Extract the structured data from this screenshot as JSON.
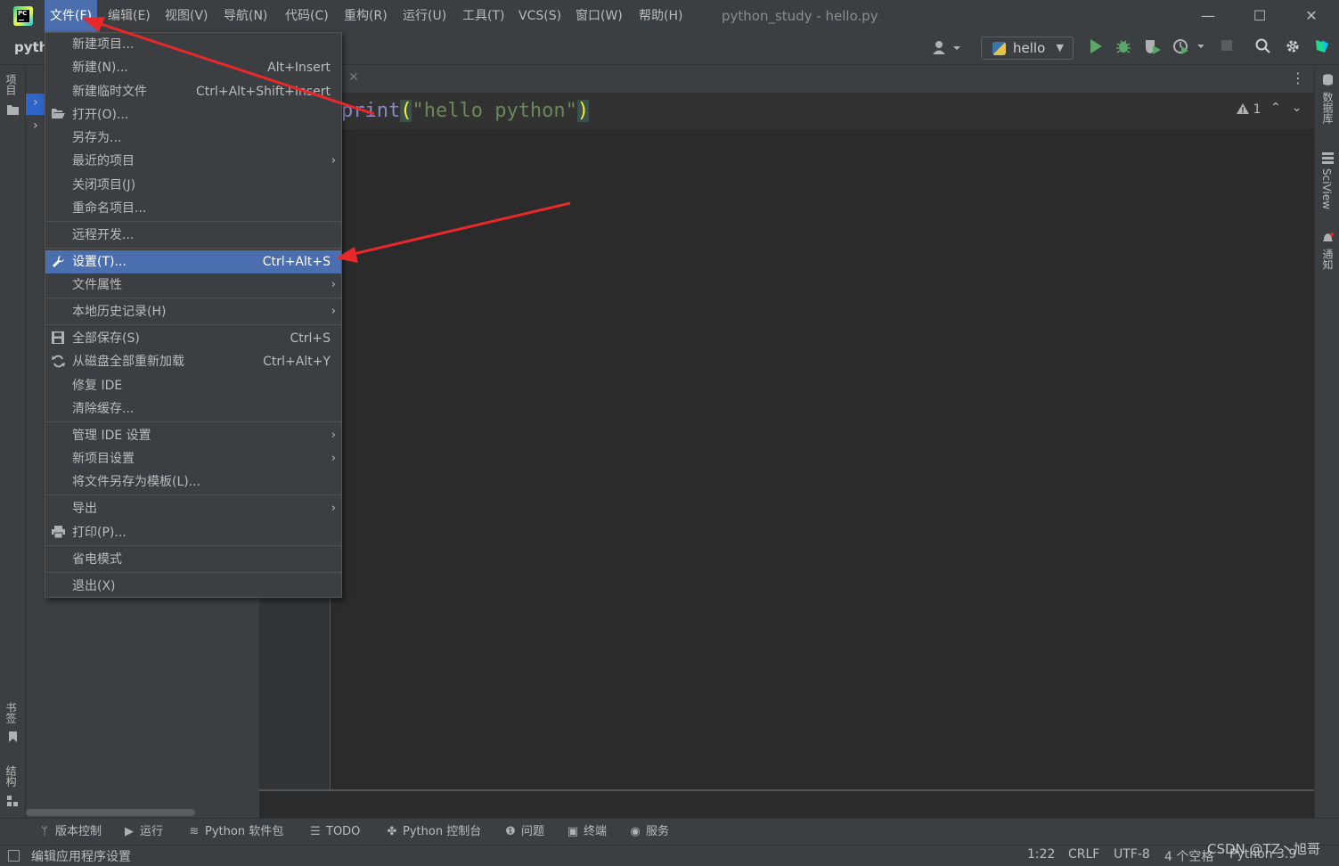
{
  "window": {
    "title": "python_study - hello.py",
    "minimize_glyph": "—",
    "maximize_glyph": "☐",
    "close_glyph": "✕"
  },
  "menubar": {
    "items": [
      "文件(F)",
      "编辑(E)",
      "视图(V)",
      "导航(N)",
      "代码(C)",
      "重构(R)",
      "运行(U)",
      "工具(T)",
      "VCS(S)",
      "窗口(W)",
      "帮助(H)"
    ],
    "active_index": 0
  },
  "toolbar": {
    "project_crumb": "pyth",
    "run_config": "hello",
    "icons": [
      "user-icon",
      "run-icon",
      "debug-icon",
      "coverage-icon",
      "profile-icon",
      "stop-icon",
      "search-icon",
      "settings-icon",
      "jetbrains-icon"
    ]
  },
  "left_strip": {
    "project_tab": "项目",
    "bookmarks_tab": "书签",
    "structure_tab": "结构"
  },
  "right_strip": {
    "database_tab": "数据库",
    "sciview_tab": "SciView",
    "notifications_tab": "通知"
  },
  "editor": {
    "code": {
      "func": "print",
      "open_paren": "(",
      "string": "\"hello python\"",
      "close_paren": ")"
    },
    "inspection_count": "1",
    "inspection_icon": "warning-icon"
  },
  "file_menu": {
    "items": [
      {
        "label": "新建项目...",
        "shortcut": "",
        "submenu": false,
        "icon": ""
      },
      {
        "label": "新建(N)...",
        "shortcut": "Alt+Insert",
        "submenu": false,
        "icon": ""
      },
      {
        "label": "新建临时文件",
        "shortcut": "Ctrl+Alt+Shift+Insert",
        "submenu": false,
        "icon": ""
      },
      {
        "label": "打开(O)...",
        "shortcut": "",
        "submenu": false,
        "icon": "folder-icon"
      },
      {
        "label": "另存为...",
        "shortcut": "",
        "submenu": false,
        "icon": ""
      },
      {
        "label": "最近的项目",
        "shortcut": "",
        "submenu": true,
        "icon": ""
      },
      {
        "label": "关闭项目(J)",
        "shortcut": "",
        "submenu": false,
        "icon": ""
      },
      {
        "label": "重命名项目...",
        "shortcut": "",
        "submenu": false,
        "icon": ""
      },
      {
        "label": "远程开发...",
        "shortcut": "",
        "submenu": false,
        "icon": ""
      },
      {
        "label": "设置(T)...",
        "shortcut": "Ctrl+Alt+S",
        "submenu": false,
        "icon": "wrench-icon",
        "selected": true
      },
      {
        "label": "文件属性",
        "shortcut": "",
        "submenu": true,
        "icon": ""
      },
      {
        "label": "本地历史记录(H)",
        "shortcut": "",
        "submenu": true,
        "icon": ""
      },
      {
        "label": "全部保存(S)",
        "shortcut": "Ctrl+S",
        "submenu": false,
        "icon": "save-icon"
      },
      {
        "label": "从磁盘全部重新加载",
        "shortcut": "Ctrl+Alt+Y",
        "submenu": false,
        "icon": "reload-icon"
      },
      {
        "label": "修复 IDE",
        "shortcut": "",
        "submenu": false,
        "icon": ""
      },
      {
        "label": "清除缓存...",
        "shortcut": "",
        "submenu": false,
        "icon": ""
      },
      {
        "label": "管理 IDE 设置",
        "shortcut": "",
        "submenu": true,
        "icon": ""
      },
      {
        "label": "新项目设置",
        "shortcut": "",
        "submenu": true,
        "icon": ""
      },
      {
        "label": "将文件另存为模板(L)...",
        "shortcut": "",
        "submenu": false,
        "icon": ""
      },
      {
        "label": "导出",
        "shortcut": "",
        "submenu": true,
        "icon": ""
      },
      {
        "label": "打印(P)...",
        "shortcut": "",
        "submenu": false,
        "icon": "print-icon"
      },
      {
        "label": "省电模式",
        "shortcut": "",
        "submenu": false,
        "icon": ""
      },
      {
        "label": "退出(X)",
        "shortcut": "",
        "submenu": false,
        "icon": ""
      }
    ]
  },
  "tool_windows": [
    {
      "label": "版本控制",
      "icon": "vcs-branch-icon"
    },
    {
      "label": "运行",
      "icon": "run-icon"
    },
    {
      "label": "Python 软件包",
      "icon": "packages-icon"
    },
    {
      "label": "TODO",
      "icon": "todo-list-icon"
    },
    {
      "label": "Python 控制台",
      "icon": "python-console-icon"
    },
    {
      "label": "问题",
      "icon": "problems-icon"
    },
    {
      "label": "终端",
      "icon": "terminal-icon"
    },
    {
      "label": "服务",
      "icon": "services-icon"
    }
  ],
  "status_bar": {
    "message": "编辑应用程序设置",
    "position": "1:22",
    "line_sep": "CRLF",
    "encoding": "UTF-8",
    "indent": "4 个空格",
    "interpreter": "Python 3.9"
  },
  "watermark": "CSDN @TZ丶旭哥",
  "colors": {
    "background": "#2b2b2b",
    "panel": "#3c3f41",
    "selection": "#4b6eaf",
    "annotation_arrow": "#e8282b"
  }
}
